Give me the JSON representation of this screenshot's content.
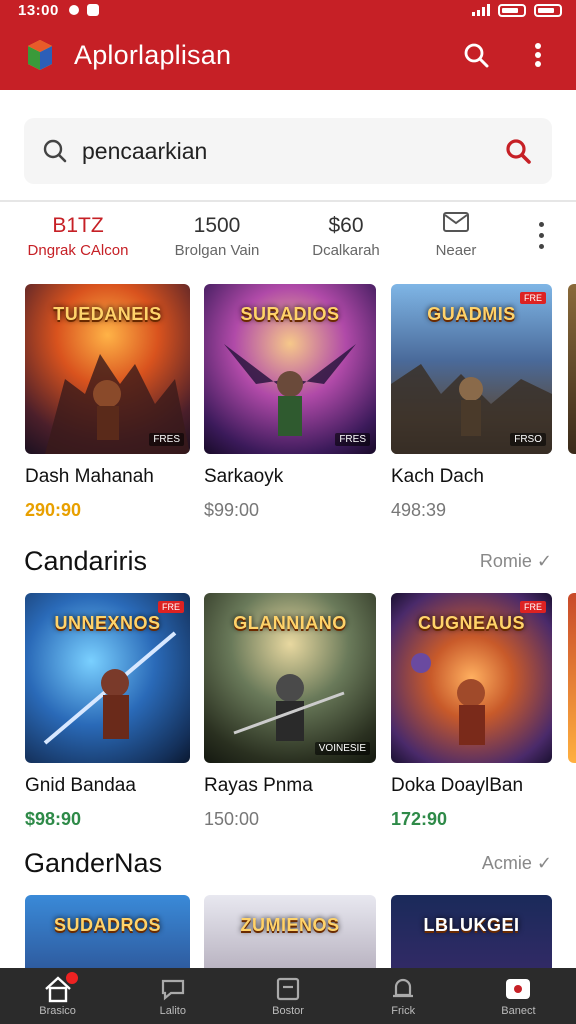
{
  "status": {
    "time": "13:00"
  },
  "app": {
    "title": "Aplorlaplisan"
  },
  "search": {
    "value": "pencaarkian"
  },
  "stats": [
    {
      "value": "B1TZ",
      "label": "Dngrak CAlcon",
      "active": true
    },
    {
      "value": "1500",
      "label": "Brolgan Vain",
      "active": false
    },
    {
      "value": "$60",
      "label": "Dcalkarah",
      "active": false
    },
    {
      "value": "",
      "label": "Neaer",
      "icon": "mail-icon",
      "active": false
    }
  ],
  "rows": [
    {
      "games": [
        {
          "title_art": "TUEDANEIS",
          "name": "Dash Mahanah",
          "price": "290:90",
          "price_style": "orange",
          "badge": "FRES"
        },
        {
          "title_art": "SURADIOS",
          "name": "Sarkaoyk",
          "price": "$99:00",
          "price_style": "grey",
          "badge": "FRES"
        },
        {
          "title_art": "GUADMIS",
          "name": "Kach Dach",
          "price": "498:39",
          "price_style": "grey",
          "badge": "FRSO",
          "flag": "FRE"
        }
      ]
    },
    {
      "section": "Candariris",
      "more": "Romie",
      "games": [
        {
          "title_art": "UNNEXNOS",
          "name": "Gnid Bandaa",
          "price": "$98:90",
          "price_style": "green",
          "badge": "",
          "flag": "FRE"
        },
        {
          "title_art": "GLANNIANO",
          "name": "Rayas Pnma",
          "price": "150:00",
          "price_style": "grey",
          "badge": "VOINESIE"
        },
        {
          "title_art": "CUGNEAUS",
          "name": "Doka DoaylBan",
          "price": "172:90",
          "price_style": "green",
          "badge": "",
          "flag": "FRE"
        }
      ]
    },
    {
      "section": "GanderNas",
      "more": "Acmie",
      "games": [
        {
          "title_art": "SUDADROS",
          "name": "",
          "price": "",
          "price_style": "grey"
        },
        {
          "title_art": "ZUMIENOS",
          "name": "",
          "price": "",
          "price_style": "grey"
        },
        {
          "title_art": "LBLUKGEI",
          "name": "",
          "price": "",
          "price_style": "grey"
        }
      ]
    }
  ],
  "nav": [
    {
      "label": "Brasico",
      "icon": "home-icon",
      "badge": true
    },
    {
      "label": "Lalito",
      "icon": "chat-icon"
    },
    {
      "label": "Bostor",
      "icon": "box-icon"
    },
    {
      "label": "Frick",
      "icon": "bell-icon"
    },
    {
      "label": "Banect",
      "icon": "game-icon"
    }
  ]
}
